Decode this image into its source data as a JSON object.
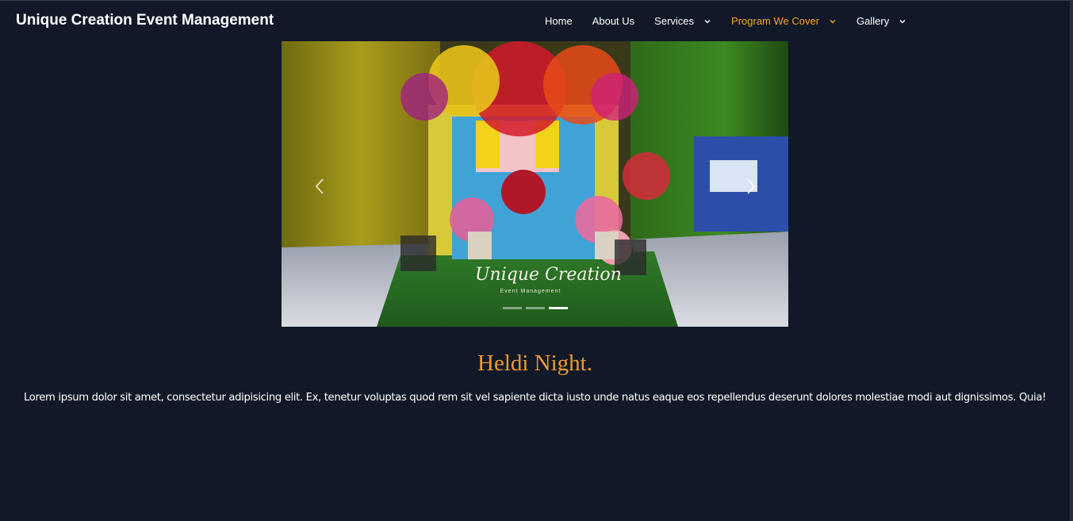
{
  "brand": "Unique Creation Event Management",
  "nav": {
    "items": [
      {
        "label": "Home",
        "has_dropdown": false,
        "active": false
      },
      {
        "label": "About Us",
        "has_dropdown": false,
        "active": false
      },
      {
        "label": "Services",
        "has_dropdown": true,
        "active": false
      },
      {
        "label": "Program We Cover",
        "has_dropdown": true,
        "active": true
      },
      {
        "label": "Gallery",
        "has_dropdown": true,
        "active": false
      }
    ]
  },
  "carousel": {
    "image_alt": "Colorful floral stage decoration with curtains and lights",
    "watermark_title": "Unique Creation",
    "watermark_subtitle": "Event Management",
    "prev_icon": "chevron-left-icon",
    "next_icon": "chevron-right-icon",
    "indicators": 3,
    "active_index": 2
  },
  "slide": {
    "title": "Heldi Night.",
    "text": "Lorem ipsum dolor sit amet, consectetur adipisicing elit. Ex, tenetur voluptas quod rem sit vel sapiente dicta iusto unde natus eaque eos repellendus deserunt dolores molestiae modi aut dignissimos. Quia!"
  },
  "colors": {
    "background": "#111827",
    "accent": "#f5a623",
    "title": "#f29a2e",
    "text": "#ffffff"
  }
}
